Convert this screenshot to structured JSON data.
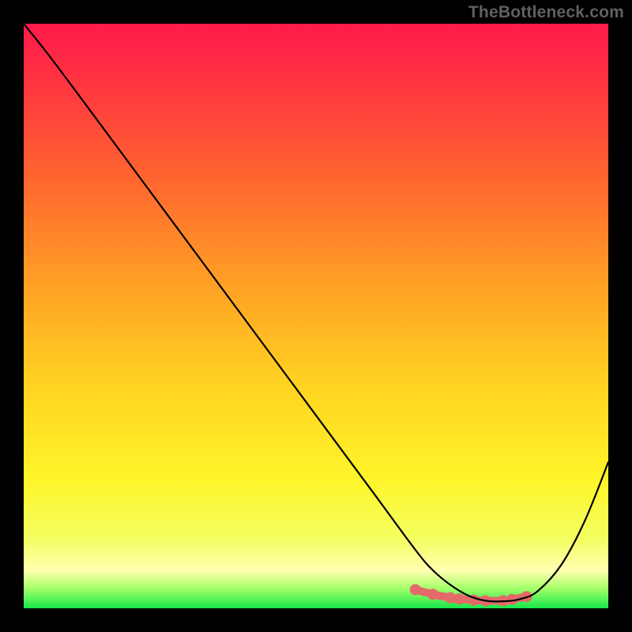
{
  "watermark": "TheBottleneck.com",
  "chart_data": {
    "type": "line",
    "title": "",
    "xlabel": "",
    "ylabel": "",
    "xlim": [
      0,
      100
    ],
    "ylim": [
      0,
      100
    ],
    "grid": false,
    "series": [
      {
        "name": "bottleneck-curve",
        "x": [
          0,
          4,
          10,
          20,
          30,
          40,
          50,
          60,
          67,
          70,
          73,
          76,
          79,
          82,
          85,
          88,
          92,
          96,
          100
        ],
        "y": [
          100,
          95,
          87,
          73.5,
          60,
          46.5,
          33,
          19.5,
          10,
          6.5,
          4,
          2.2,
          1.3,
          1.2,
          1.6,
          3.0,
          7.5,
          15,
          25
        ]
      }
    ],
    "highlight": {
      "name": "optimal-range",
      "x": [
        67,
        70,
        73,
        74.5,
        77,
        79,
        82,
        83.5,
        86
      ],
      "y": [
        3.2,
        2.4,
        1.8,
        1.6,
        1.4,
        1.3,
        1.3,
        1.5,
        2.0
      ]
    },
    "gradient_stops": [
      {
        "offset": 0.0,
        "color": "#ff1a4b"
      },
      {
        "offset": 0.12,
        "color": "#ff3a3e"
      },
      {
        "offset": 0.28,
        "color": "#ff6a2e"
      },
      {
        "offset": 0.45,
        "color": "#ffa225"
      },
      {
        "offset": 0.62,
        "color": "#ffd321"
      },
      {
        "offset": 0.78,
        "color": "#fff52a"
      },
      {
        "offset": 0.88,
        "color": "#f3ff60"
      },
      {
        "offset": 0.935,
        "color": "#ffffb0"
      },
      {
        "offset": 0.965,
        "color": "#a8ff6a"
      },
      {
        "offset": 1.0,
        "color": "#17e84a"
      }
    ],
    "highlight_style": {
      "stroke": "#e46a6a",
      "stroke_width": 10,
      "dot_radius": 7
    },
    "curve_style": {
      "stroke": "#000000",
      "stroke_width": 2.2
    }
  }
}
